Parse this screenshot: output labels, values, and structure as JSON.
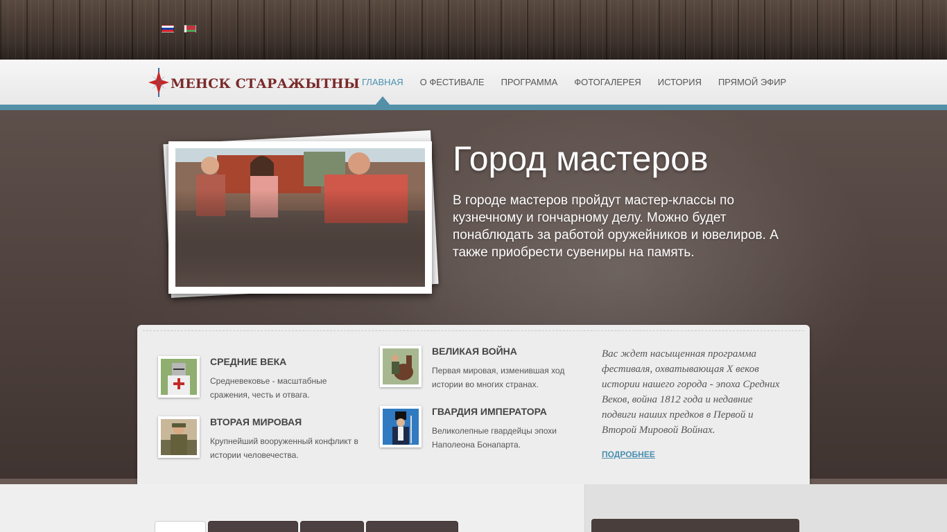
{
  "languages": [
    {
      "code": "ru",
      "name": "Русский"
    },
    {
      "code": "by",
      "name": "Беларуская"
    }
  ],
  "logo": {
    "text": "Менск Старажытны"
  },
  "nav": {
    "items": [
      "Главная",
      "О фестивале",
      "Программа",
      "Фотогалерея",
      "История",
      "Прямой эфир"
    ],
    "active_index": 0
  },
  "hero": {
    "title": "Город мастеров",
    "text": "В городе мастеров пройдут мастер-классы по кузнечному и гончарному делу. Можно будет понаблюдать за работой оружейников и ювелиров. А также приобрести сувениры на память."
  },
  "features": [
    {
      "title": "Средние века",
      "text": "Средневековье - масштабные сражения, честь и отвага.",
      "icon": "knight-thumbnail"
    },
    {
      "title": "Вторая мировая",
      "text": "Крупнейший вооруженный конфликт в истории человечества.",
      "icon": "soldier-thumbnail"
    },
    {
      "title": "Великая война",
      "text": "Первая мировая, изменившая ход истории во многих странах.",
      "icon": "cavalry-thumbnail"
    },
    {
      "title": "Гвардия императора",
      "text": "Великолепные гвардейцы эпохи Наполеона Бонапарта.",
      "icon": "guard-thumbnail"
    }
  ],
  "panel": {
    "quote": "Вас ждет насыщенная программа фестиваля, охватывающая X веков истории нашего города - эпоха Средних Веков, война 1812 года и недавние подвиги наших предков в Первой и Второй Мировой Войнах.",
    "more_label": "ПОДРОБНЕЕ"
  },
  "colors": {
    "accent": "#5390a8",
    "hero_bg": "#4c3f3b",
    "logo": "#7a2a2a"
  }
}
